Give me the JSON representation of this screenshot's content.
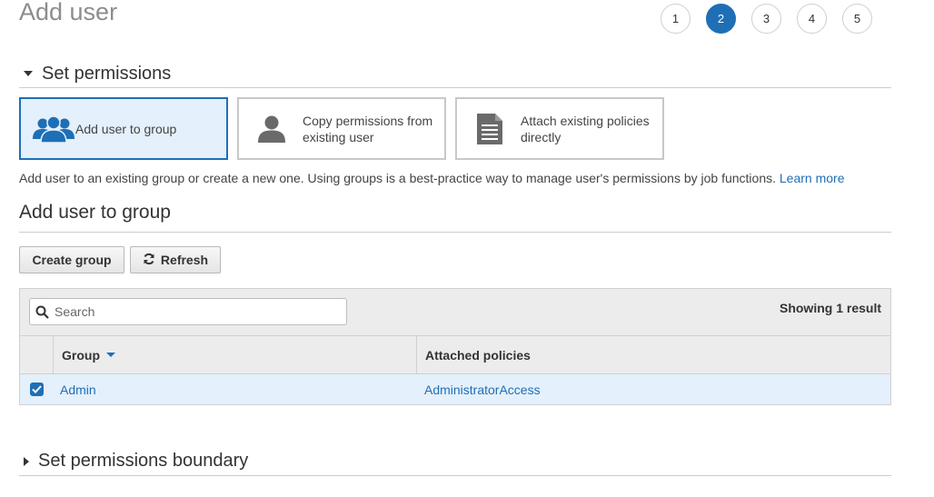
{
  "page": {
    "title": "Add user"
  },
  "steps": [
    "1",
    "2",
    "3",
    "4",
    "5"
  ],
  "sections": {
    "permissions": "Set permissions",
    "boundary": "Set permissions boundary"
  },
  "options": {
    "group": {
      "line1": "Add user to group",
      "icon": "users-group-icon"
    },
    "copy": {
      "line1": "Copy permissions from",
      "line2": "existing user",
      "icon": "user-icon"
    },
    "attach": {
      "line1": "Attach existing policies",
      "line2": "directly",
      "icon": "document-icon"
    }
  },
  "description": {
    "text": "Add user to an existing group or create a new one. Using groups is a best-practice way to manage user's permissions by job functions.",
    "link": "Learn more"
  },
  "group_section": {
    "title": "Add user to group",
    "create_button": "Create group",
    "refresh_button": "Refresh"
  },
  "table": {
    "search_placeholder": "Search",
    "showing": "Showing 1 result",
    "columns": [
      "Group",
      "Attached policies"
    ],
    "rows": [
      {
        "group": "Admin",
        "policies": "AdministratorAccess",
        "checked": true
      }
    ]
  },
  "colors": {
    "accent": "#1f6fb6",
    "selected_bg": "#e4f0fb"
  }
}
